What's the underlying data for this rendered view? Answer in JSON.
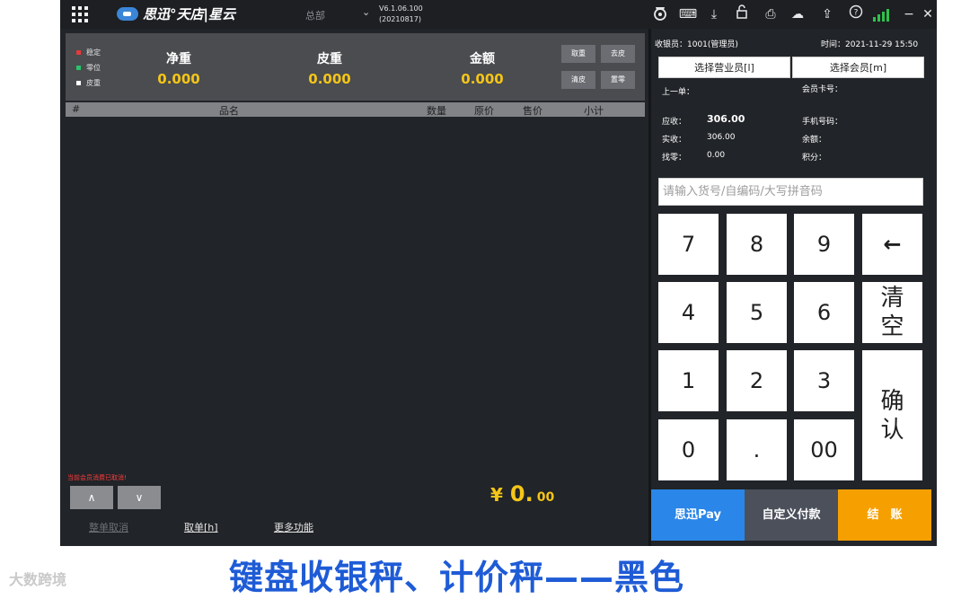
{
  "topbar": {
    "brand": "思迅°天店|星云",
    "branch": "总部",
    "branch_caret": "⌄",
    "version_line1": "V6.1.06.100",
    "version_line2": "(20210817)",
    "icons": [
      "scale-icon",
      "keyboard-icon",
      "download-icon",
      "lock-icon",
      "printer-icon",
      "cloud-icon",
      "cloud-upload-icon",
      "help-icon",
      "signal-icon",
      "minimize-icon",
      "close-icon"
    ],
    "icon_glyphs": {
      "keyboard": "⌨",
      "download": "⤓",
      "lock": "🔓",
      "printer": "⎙",
      "cloud": "☁",
      "upload": "⇪",
      "help": "?",
      "minimize": "−",
      "close": "✕"
    }
  },
  "weigh": {
    "status": [
      {
        "label": "稳定",
        "color": "#e23b3b"
      },
      {
        "label": "零位",
        "color": "#28c46a"
      },
      {
        "label": "皮重",
        "color": "#ffffff"
      }
    ],
    "net_label": "净重",
    "net_value": "0.000",
    "tare_label": "皮重",
    "tare_value": "0.000",
    "amount_label": "金额",
    "amount_value": "0.000",
    "btn_take_weight": "取重",
    "btn_remove_tare": "去皮",
    "btn_clear_tare": "清皮",
    "btn_zero": "置零"
  },
  "items": {
    "headers": [
      "#",
      "品名",
      "数量",
      "原价",
      "售价",
      "小计"
    ]
  },
  "footer": {
    "warning": "当前会员消费已取消!",
    "up_label": "∧",
    "down_label": "∨",
    "total_currency": "¥",
    "total_integer": "0.",
    "total_decimal": "00",
    "whole_cancel": "整单取消",
    "retrieve": "取单[h]",
    "more": "更多功能"
  },
  "right": {
    "cashier": "收银员：1001(管理员)",
    "time": "时间：2021-11-29 15:50",
    "select_clerk": "选择营业员[l]",
    "select_member": "选择会员[m]",
    "last_order": "上一单：",
    "member_card": "会员卡号：",
    "receivable_label": "应收：",
    "receivable_value": "306.00",
    "received_label": "实收：",
    "received_value": "306.00",
    "change_label": "找零：",
    "change_value": "0.00",
    "phone_label": "手机号码：",
    "balance_label": "余额：",
    "points_label": "积分：",
    "search_placeholder": "请输入货号/自编码/大写拼音码"
  },
  "keypad": {
    "k7": "7",
    "k8": "8",
    "k9": "9",
    "back": "←",
    "k4": "4",
    "k5": "5",
    "k6": "6",
    "clear_1": "清",
    "clear_2": "空",
    "k1": "1",
    "k2": "2",
    "k3": "3",
    "confirm_1": "确",
    "confirm_2": "认",
    "k0": "0",
    "dot": ".",
    "k00": "00"
  },
  "payment": {
    "sixun_pay": "思迅Pay",
    "custom_pay": "自定义付款",
    "checkout": "结　账",
    "colors": {
      "sixun_pay": "#2a86e8",
      "custom_pay": "#4b505b",
      "checkout": "#f5a000"
    }
  },
  "caption": "键盘收银秤、计价秤——黑色",
  "watermark": "大数跨境"
}
